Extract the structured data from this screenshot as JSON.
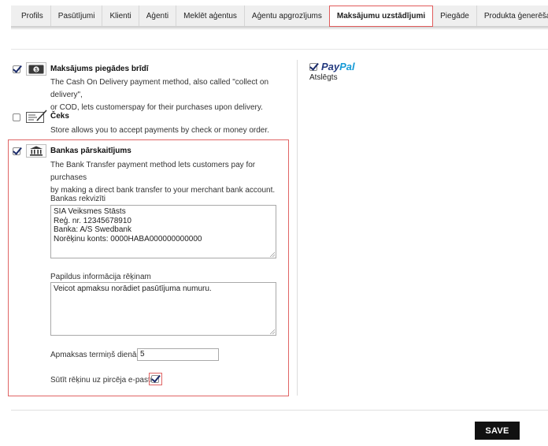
{
  "tabs": [
    {
      "label": "Profils"
    },
    {
      "label": "Pasūtījumi"
    },
    {
      "label": "Klienti"
    },
    {
      "label": "Aģenti"
    },
    {
      "label": "Meklēt aģentus"
    },
    {
      "label": "Aģentu apgrozījums"
    },
    {
      "label": "Maksājumu uzstādījumi",
      "active": true
    },
    {
      "label": "Piegāde"
    },
    {
      "label": "Produkta ģenerēšana"
    }
  ],
  "methods": {
    "cod": {
      "enabled": true,
      "icon": "cash-icon",
      "title": "Maksājums piegādes brīdī",
      "description_line1": "The Cash On Delivery payment method, also called \"collect on delivery\",",
      "description_line2": "or COD, lets customerspay for their purchases upon delivery."
    },
    "cheque": {
      "enabled": false,
      "icon": "cheque-icon",
      "title": "Čeks",
      "description": "Store allows you to accept payments by check or money order."
    },
    "bank": {
      "enabled": true,
      "icon": "bank-icon",
      "title": "Bankas pārskaitījums",
      "description_line1": "The Bank Transfer payment method lets customers pay for purchases",
      "description_line2": "by making a direct bank transfer to your merchant bank account.",
      "details_label": "Bankas rekvizīti",
      "details_value": "SIA Veiksmes Stāsts\nReģ. nr. 12345678910\nBanka: A/S Swedbank\nNorēķinu konts: 0000HABA000000000000",
      "extra_info_label": "Papildus informācija rēķinam",
      "extra_info_value": "Veicot apmaksu norādiet pasūtījuma numuru.",
      "payment_term_label": "Apmaksas termiņš dienās",
      "payment_term_value": "5",
      "send_invoice_label": "Sūtīt rēķinu uz pircēja e-pastu",
      "send_invoice_checked": true
    }
  },
  "paypal": {
    "enabled": true,
    "logo_part1": "Pay",
    "logo_part2": "Pal",
    "status": "Atslēgts"
  },
  "save_label": "SAVE",
  "colors": {
    "accent_border": "#e06565",
    "paypal_dark": "#253b80",
    "paypal_light": "#179bd7",
    "save_bg": "#111111"
  }
}
